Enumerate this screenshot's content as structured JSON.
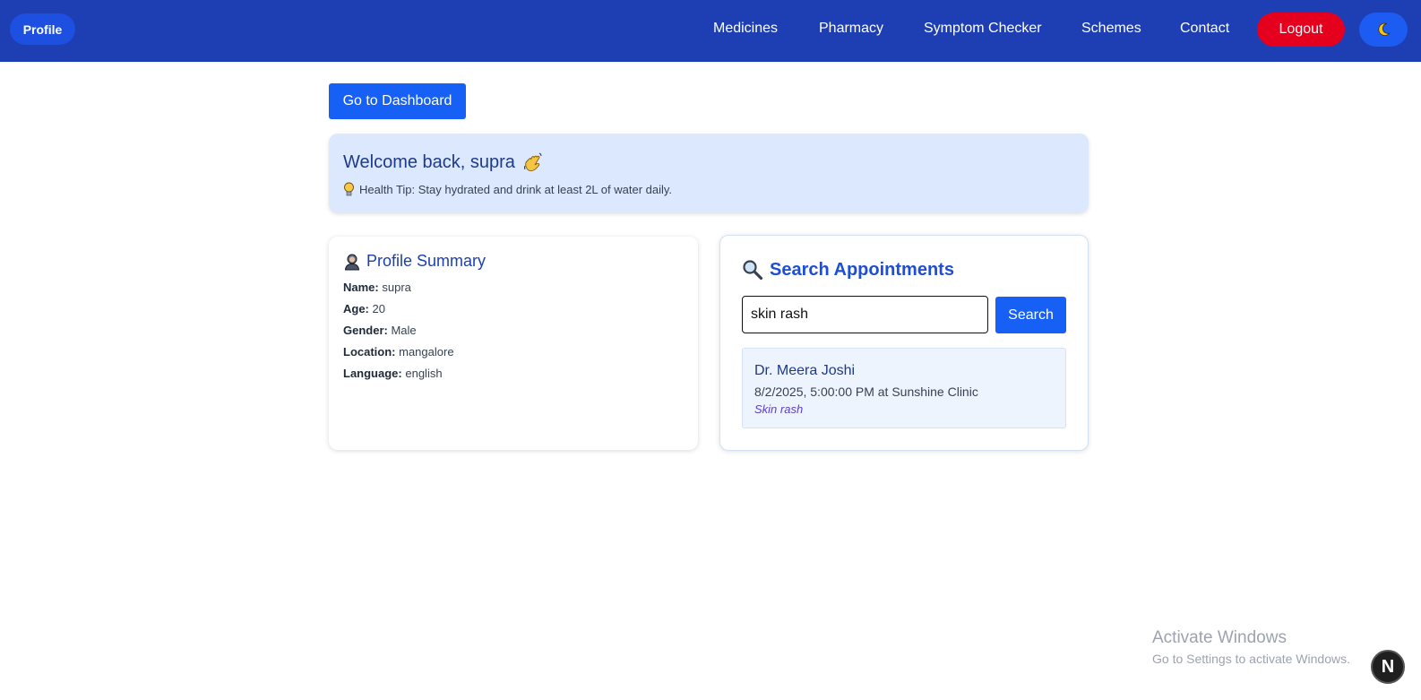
{
  "navbar": {
    "profile_label": "Profile",
    "links": [
      "Medicines",
      "Pharmacy",
      "Symptom Checker",
      "Schemes",
      "Contact"
    ],
    "logout_label": "Logout",
    "theme_icon": "moon-icon"
  },
  "dashboard_button": "Go to Dashboard",
  "welcome": {
    "title": "Welcome back, supra",
    "wave_icon": "waving-hand-icon",
    "tip_icon": "lightbulb-icon",
    "tip": "Health Tip: Stay hydrated and drink at least 2L of water daily."
  },
  "profile_summary": {
    "title": "Profile Summary",
    "icon": "person-icon",
    "fields": [
      {
        "label": "Name:",
        "value": "supra"
      },
      {
        "label": "Age:",
        "value": "20"
      },
      {
        "label": "Gender:",
        "value": "Male"
      },
      {
        "label": "Location:",
        "value": "mangalore"
      },
      {
        "label": "Language:",
        "value": "english"
      }
    ]
  },
  "search_appointments": {
    "title": "Search Appointments",
    "icon": "magnifier-icon",
    "query": "skin rash",
    "button": "Search",
    "results": [
      {
        "doctor": "Dr. Meera Joshi",
        "datetime": "8/2/2025, 5:00:00 PM at Sunshine Clinic",
        "reason": "Skin rash"
      }
    ]
  },
  "watermark": {
    "line1": "Activate Windows",
    "line2": "Go to Settings to activate Windows."
  },
  "dev_badge": "N",
  "colors": {
    "navbar": "#1e3fb4",
    "primary": "#1660f5",
    "logout": "#e5001e",
    "welcome_bg": "#dbe8fd"
  }
}
